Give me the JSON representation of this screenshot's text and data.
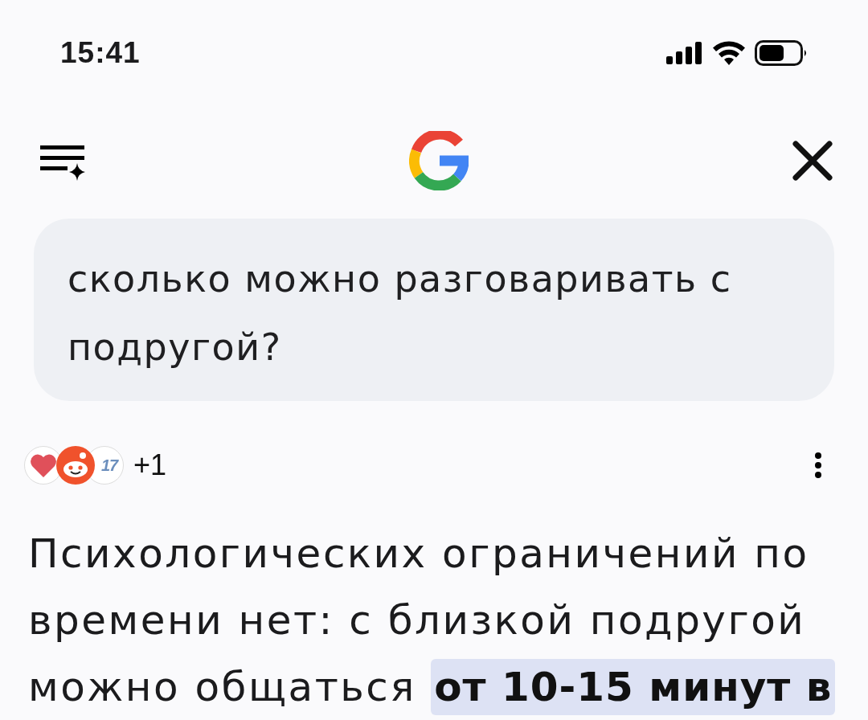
{
  "status_bar": {
    "time": "15:41"
  },
  "query": {
    "text": "сколько можно разговаривать с подругой?"
  },
  "sources": {
    "icons": [
      {
        "kind": "heart"
      },
      {
        "kind": "mascot"
      },
      {
        "kind": "site_logo",
        "text": "17"
      }
    ],
    "more_count": "+1"
  },
  "answer": {
    "text": "Психологических ограничений по времени нет: с близкой подругой можно общаться **от 10-15 минут в**"
  }
}
